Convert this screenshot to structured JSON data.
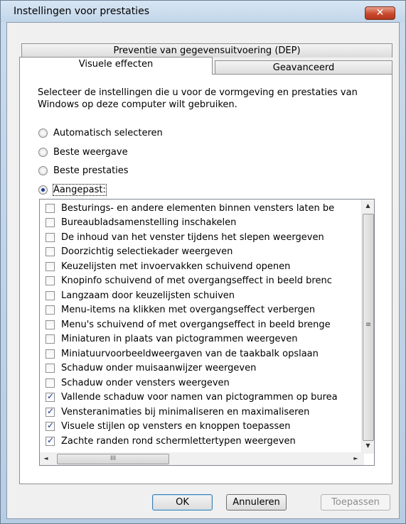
{
  "window": {
    "title": "Instellingen voor prestaties",
    "close_symbol": "✕"
  },
  "tabs": {
    "dep": "Preventie van gegevensuitvoering (DEP)",
    "visual": "Visuele effecten",
    "advanced": "Geavanceerd"
  },
  "description": "Selecteer de instellingen die u voor de vormgeving en prestaties van Windows op deze computer wilt gebruiken.",
  "radios": [
    {
      "label": "Automatisch selecteren",
      "checked": false
    },
    {
      "label": "Beste weergave",
      "checked": false
    },
    {
      "label": "Beste prestaties",
      "checked": false
    },
    {
      "label": "Aangepast:",
      "checked": true
    }
  ],
  "effects": [
    {
      "label": "Besturings- en andere elementen binnen vensters laten be",
      "checked": false
    },
    {
      "label": "Bureaubladsamenstelling inschakelen",
      "checked": false
    },
    {
      "label": "De inhoud van het venster tijdens het slepen weergeven",
      "checked": false
    },
    {
      "label": "Doorzichtig selectiekader weergeven",
      "checked": false
    },
    {
      "label": "Keuzelijsten met invoervakken schuivend openen",
      "checked": false
    },
    {
      "label": "Knopinfo schuivend of met overgangseffect in beeld brenc",
      "checked": false
    },
    {
      "label": "Langzaam door keuzelijsten schuiven",
      "checked": false
    },
    {
      "label": "Menu-items na klikken met overgangseffect verbergen",
      "checked": false
    },
    {
      "label": "Menu's schuivend of met overgangseffect in beeld brenge",
      "checked": false
    },
    {
      "label": "Miniaturen in plaats van pictogrammen weergeven",
      "checked": false
    },
    {
      "label": "Miniatuurvoorbeeldweergaven van de taakbalk opslaan",
      "checked": false
    },
    {
      "label": "Schaduw onder muisaanwijzer weergeven",
      "checked": false
    },
    {
      "label": "Schaduw onder vensters weergeven",
      "checked": false
    },
    {
      "label": "Vallende schaduw voor namen van pictogrammen op burea",
      "checked": true
    },
    {
      "label": "Vensteranimaties bij minimaliseren en maximaliseren",
      "checked": true
    },
    {
      "label": "Visuele stijlen op vensters en knoppen toepassen",
      "checked": true
    },
    {
      "label": "Zachte randen rond schermlettertypen weergeven",
      "checked": true
    }
  ],
  "scroll": {
    "up": "▲",
    "down": "▼",
    "left": "◄",
    "right": "►",
    "h_grip": "III",
    "v_grip": "≡"
  },
  "buttons": {
    "ok": "OK",
    "cancel": "Annuleren",
    "apply": "Toepassen"
  },
  "colors": {
    "close_button": "#c94a2e",
    "check": "#21388f",
    "panel": "#ffffff",
    "dialog_bg": "#f0f0f0"
  }
}
